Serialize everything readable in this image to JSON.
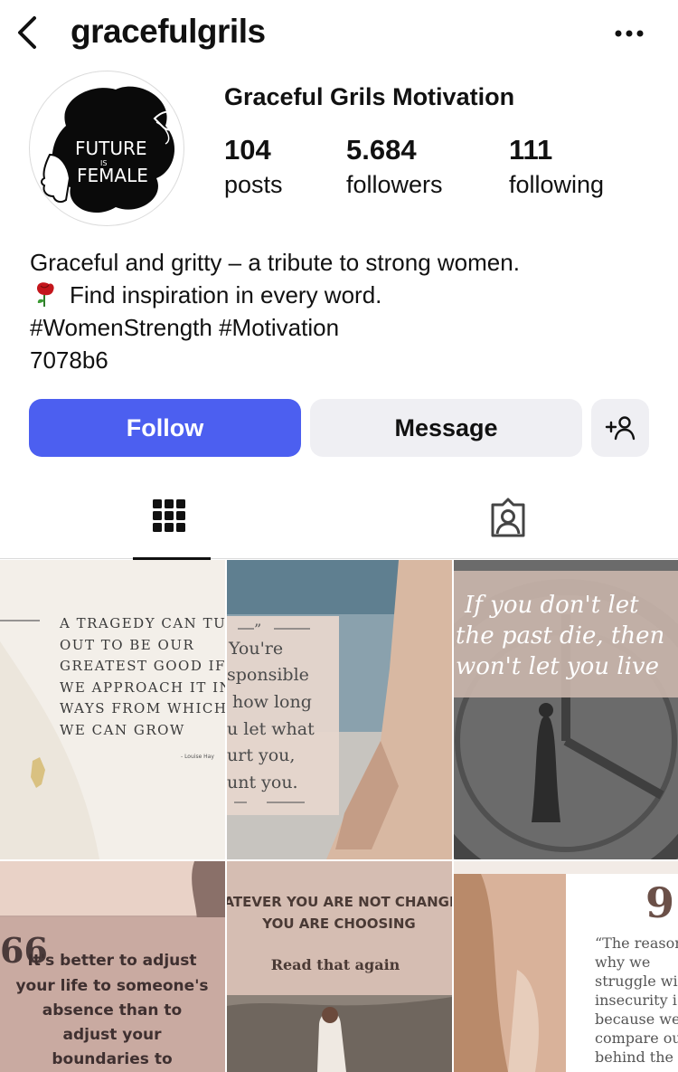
{
  "header": {
    "username": "gracefulgrils",
    "back_icon": "chevron-left-icon",
    "more_icon": "more-horizontal-icon"
  },
  "profile": {
    "display_name": "Graceful Grils Motivation",
    "avatar_text_line1": "FUTURE",
    "avatar_text_line2": "IS",
    "avatar_text_line3": "FEMALE",
    "stats": {
      "posts": {
        "value": "104",
        "label": "posts"
      },
      "followers": {
        "value": "5.684",
        "label": "followers"
      },
      "following": {
        "value": "111",
        "label": "following"
      }
    },
    "bio": {
      "line1": "Graceful and gritty – a tribute to strong women.",
      "line2": "Find inspiration in every word.",
      "line3": "#WomenStrength #Motivation",
      "line4": "7078b6"
    }
  },
  "actions": {
    "follow_label": "Follow",
    "message_label": "Message",
    "add_user_icon": "add-user-icon"
  },
  "tabs": {
    "grid_icon": "grid-icon",
    "tagged_icon": "tagged-user-icon"
  },
  "colors": {
    "follow_button": "#4c5ff0",
    "secondary_button": "#efeff3"
  },
  "posts": [
    {
      "lines": [
        "A TRAGEDY CAN TU",
        "OUT TO BE OUR",
        "GREATEST GOOD IF",
        "WE APPROACH IT IN",
        "WAYS FROM WHICH",
        "WE CAN GROW"
      ],
      "author": "- Louise Hay"
    },
    {
      "quote_mark": "”",
      "lines": [
        "You're",
        "sponsible",
        "how long",
        "u let what",
        "urt you,",
        "unt you."
      ]
    },
    {
      "lines": [
        "If you don't let",
        "the past die, then",
        "won't let you live"
      ]
    },
    {
      "quote_mark": "66",
      "lines": [
        "It's better to adjust",
        "your life to someone's",
        "absence than to",
        "adjust your",
        "boundaries to"
      ]
    },
    {
      "lines": [
        "ATEVER YOU ARE NOT CHANGI",
        "YOU ARE CHOOSING",
        "Read that again"
      ]
    },
    {
      "quote_mark": "9",
      "lines": [
        "“The reasor",
        "why we",
        "struggle wit",
        "insecurity i",
        "because we",
        "compare ou",
        "behind the"
      ]
    }
  ]
}
